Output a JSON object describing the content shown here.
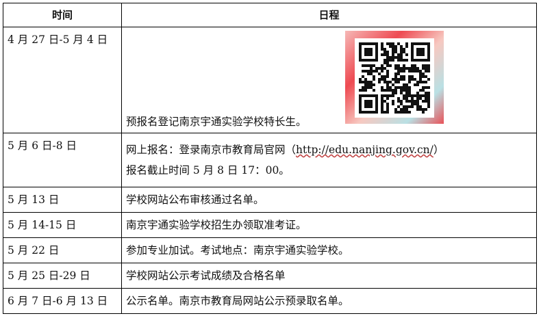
{
  "header": {
    "time": "时间",
    "schedule": "日程"
  },
  "rows": [
    {
      "time": "4 月 27 日-5 月 4 日",
      "event": "预报名登记南京宇通实验学校特长生。"
    },
    {
      "time": "5 月 6 日-8 日",
      "event_prefix": "网上报名：登录南京市教育局官网（",
      "url": "http://edu.nanjing.gov.cn/",
      "event_suffix": "）",
      "event_line2": "报名截止时间 5 月 8 日 17：00。"
    },
    {
      "time": "5 月 13 日",
      "event": "学校网站公布审核通过名单。"
    },
    {
      "time": "5 月 14-15 日",
      "event": "南京宇通实验学校招生办领取准考证。"
    },
    {
      "time": "5 月 22 日",
      "event": "参加专业加试。考试地点：南京宇通实验学校。"
    },
    {
      "time": "5 月 25 日-29 日",
      "event": "学校网站公示考试成绩及合格名单"
    },
    {
      "time": "6 月 7 日-6 月 13 日",
      "event": "公示名单。南京市教育局网站公示预录取名单。"
    }
  ],
  "qr_code": {
    "icon": "qr-code-icon",
    "frame_colors": [
      "#ee4a52",
      "#f7c8c0",
      "#b9e0e4"
    ]
  }
}
